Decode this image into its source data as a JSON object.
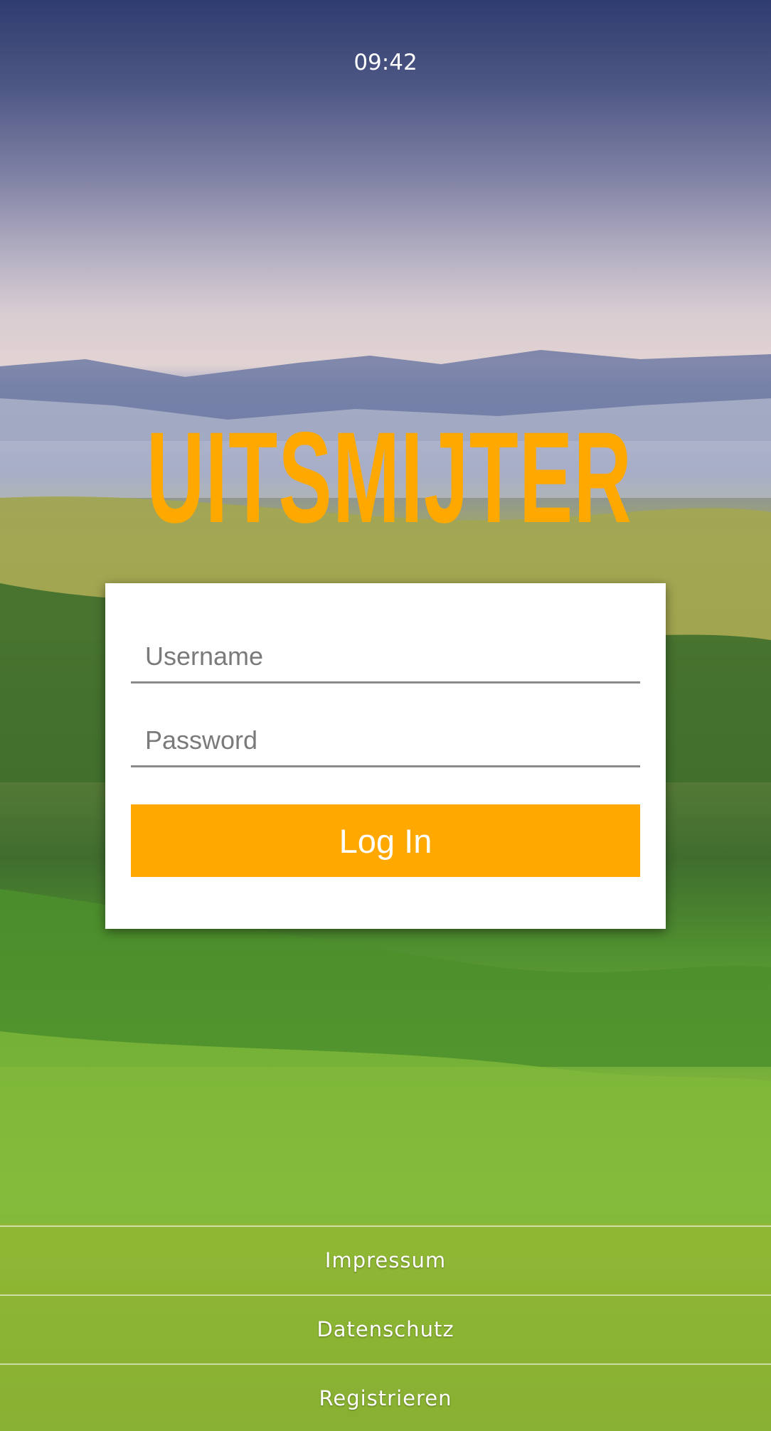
{
  "status_bar": {
    "time": "09:42"
  },
  "app": {
    "logo_text": "UITSMIJTER",
    "accent_color": "#ffa800"
  },
  "login_form": {
    "username_placeholder": "Username",
    "username_value": "",
    "password_placeholder": "Password",
    "password_value": "",
    "login_button_label": "Log In"
  },
  "footer": {
    "links": [
      {
        "label": "Impressum"
      },
      {
        "label": "Datenschutz"
      },
      {
        "label": "Registrieren"
      }
    ]
  }
}
